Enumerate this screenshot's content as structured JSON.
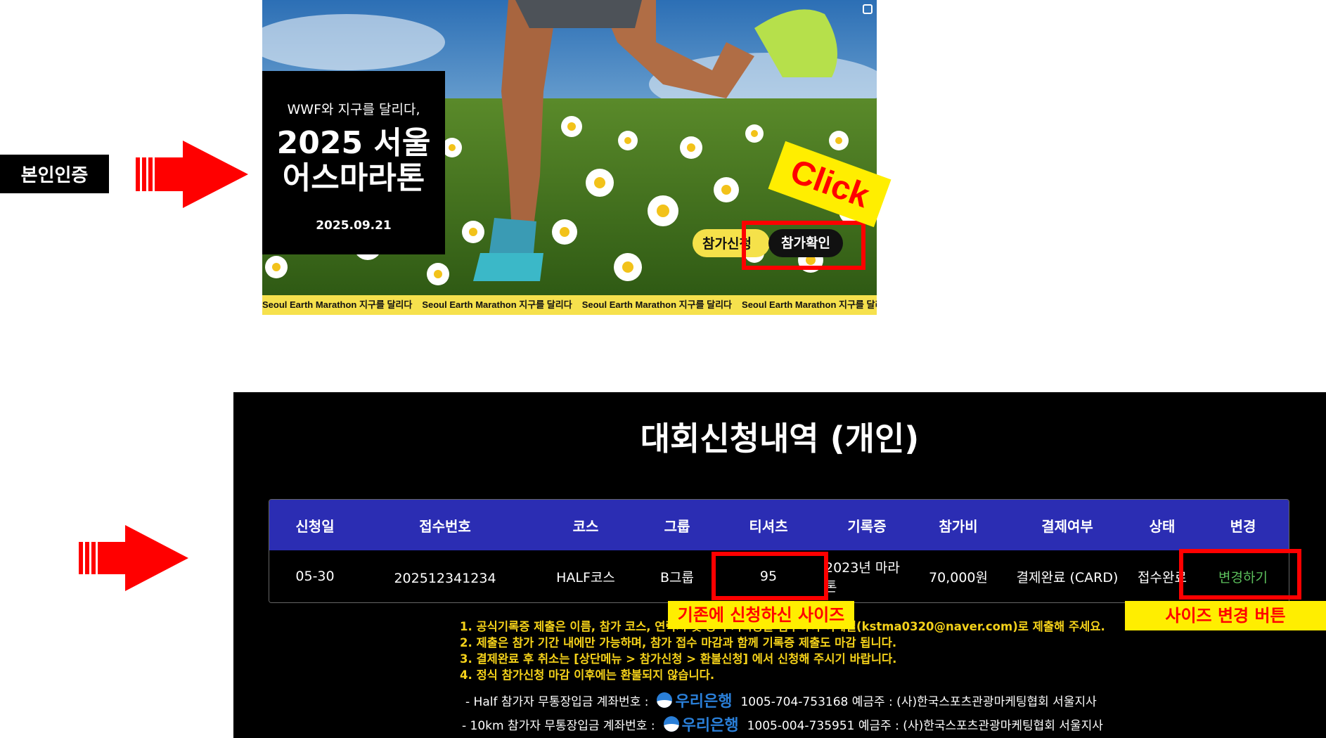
{
  "annotations": {
    "identity_label": "본인인증",
    "click_label": "Click",
    "existing_size_label": "기존에 신청하신 사이즈",
    "change_button_label": "사이즈 변경 버튼"
  },
  "banner": {
    "subtitle": "WWF와 지구를 달리다,",
    "title_line1": "2025 서울",
    "title_line2": "어스마라톤",
    "date": "2025.09.21",
    "apply_button": "참가신청",
    "confirm_button": "참가확인",
    "ticker_text": "Seoul Earth Marathon 지구를 달리다"
  },
  "panel": {
    "title": "대회신청내역 (개인)",
    "columns": [
      "신청일",
      "접수번호",
      "코스",
      "그룹",
      "티셔츠",
      "기록증",
      "참가비",
      "결제여부",
      "상태",
      "변경"
    ],
    "row": [
      "05-30",
      "202512341234",
      "HALF코스",
      "B그룹",
      "95",
      "2023년 마라톤",
      "70,000원",
      "결제완료 (CARD)",
      "접수완료",
      "변경하기"
    ],
    "notes": [
      "1. 공식기록증 제출은 이름, 참가 코스, 연락처 및 공식 기록증을 첨부하여 이메일(kstma0320@naver.com)로 제출해 주세요.",
      "2. 제출은 참가 기간 내에만 가능하며, 참가 접수 마감과 함께 기록증 제출도 마감 됩니다.",
      "3. 결제완료 후 취소는 [상단메뉴 > 참가신청 > 환불신청] 에서 신청해 주시기 바랍니다.",
      "4. 정식 참가신청 마감 이후에는 환불되지 않습니다."
    ],
    "accounts": [
      {
        "prefix": "- Half 참가자 무통장입금 계좌번호 :",
        "bank": "우리은행",
        "detail": "1005-704-753168 예금주 : (사)한국스포츠관광마케팅협회 서울지사"
      },
      {
        "prefix": "- 10km 참가자 무통장입금 계좌번호 :",
        "bank": "우리은행",
        "detail": "1005-004-735951 예금주 : (사)한국스포츠관광마케팅협회 서울지사"
      }
    ]
  },
  "colors": {
    "annotation_red": "#ff0000",
    "annotation_yellow": "#ffee00",
    "table_header": "#2b2db3",
    "notes_text": "#f5d21a",
    "change_link": "#5cc05c",
    "bank_blue": "#2a7fd8"
  }
}
